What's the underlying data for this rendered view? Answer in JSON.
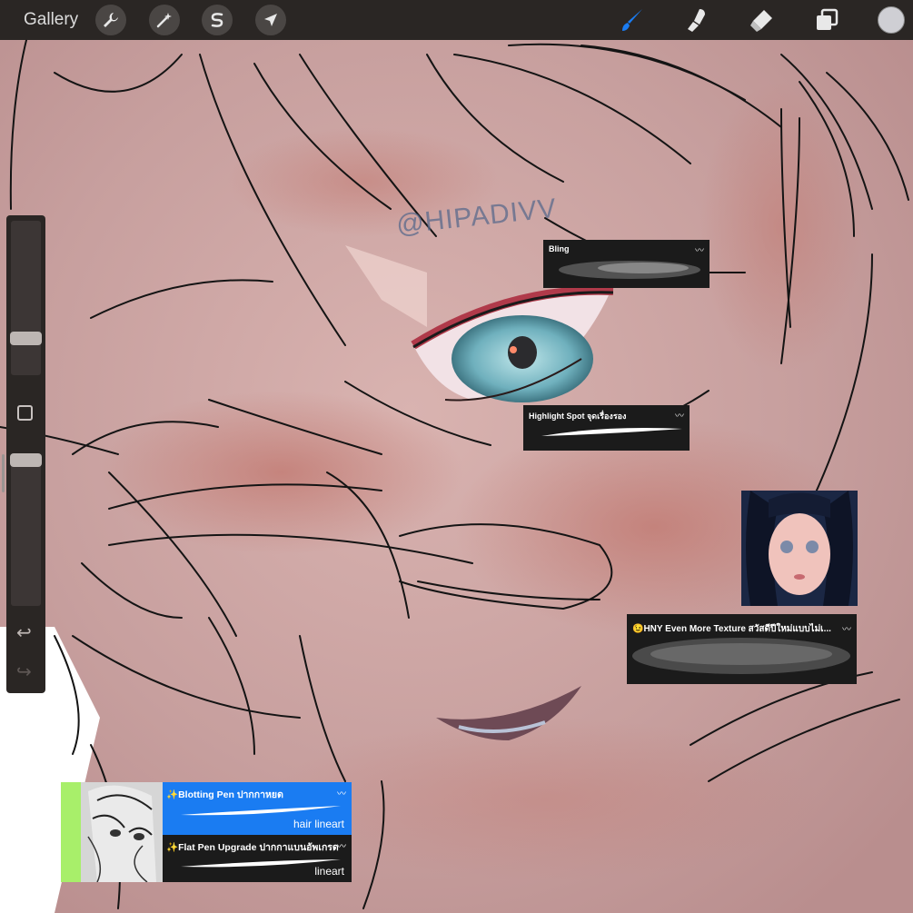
{
  "topbar": {
    "gallery_label": "Gallery",
    "tools_left": [
      "wrench-icon",
      "magic-wand-icon",
      "selection-s-icon",
      "transform-arrow-icon"
    ],
    "tools_right": [
      "brush-icon",
      "smudge-icon",
      "eraser-icon",
      "layers-icon",
      "color-swatch"
    ],
    "active_tool": "brush",
    "accent_color": "#1a7cf2",
    "current_color": "#cfcfd4"
  },
  "sidebar": {
    "brush_size_level": 0.1,
    "opacity_level": 0.95,
    "modify_button": "square-icon",
    "undo": "undo-icon",
    "redo": "redo-icon"
  },
  "canvas": {
    "watermark": "@HIPADIVV"
  },
  "brushes": {
    "bling": {
      "name": "Bling"
    },
    "highlight": {
      "name": "Highlight Spot จุดเรื่องรอง"
    },
    "hny": {
      "name": "😉HNY Even More Texture สวัสดีปีใหม่แบบไม่เ..."
    },
    "blotting": {
      "name": "✨Blotting Pen ปากกาหยด",
      "tag": "hair lineart"
    },
    "flat": {
      "name": "✨Flat Pen Upgrade ปากกาแบนอัพเกรด",
      "tag": "lineart"
    }
  }
}
